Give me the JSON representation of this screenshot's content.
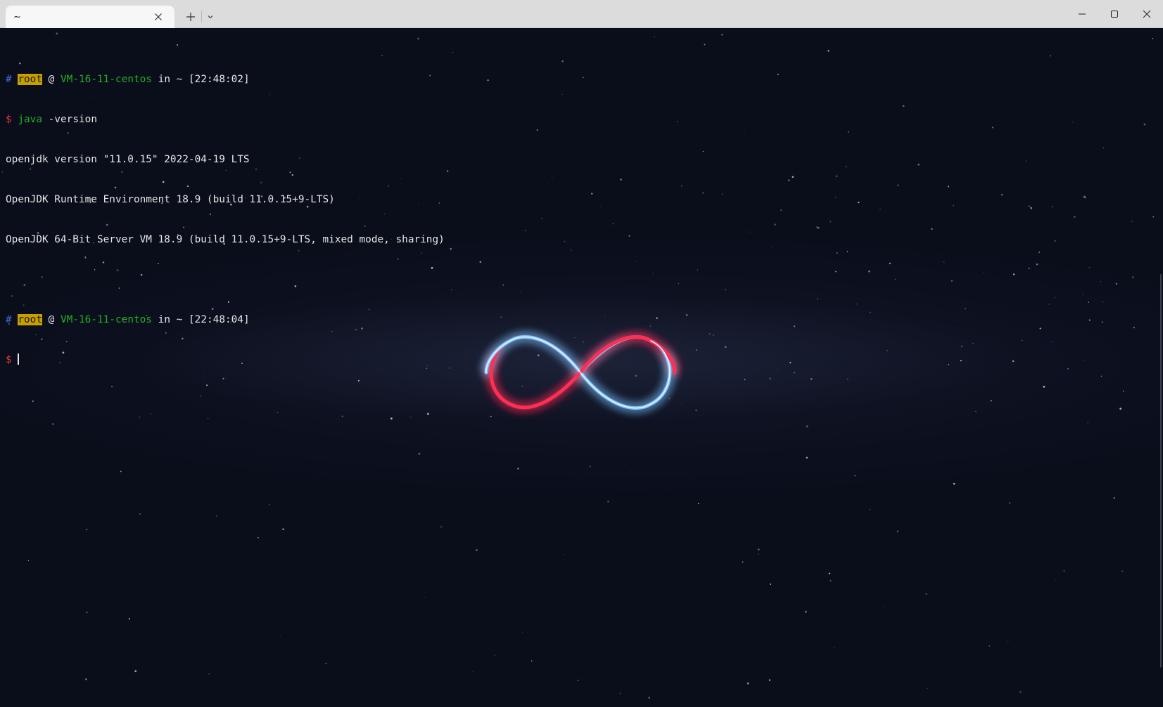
{
  "window": {
    "tab_title": "~",
    "new_tab_symbol": "+",
    "icons": {
      "tab_close": "close-icon",
      "new_tab": "plus-icon",
      "dropdown": "chevron-down-icon",
      "minimize": "minimize-icon",
      "maximize": "maximize-icon",
      "close": "close-icon"
    }
  },
  "terminal": {
    "prompt1": {
      "hash": "#",
      "user": "root",
      "at": "@",
      "host": "VM-16-11-centos",
      "in": "in",
      "dir": "~",
      "time": "[22:48:02]"
    },
    "command1": {
      "dollar": "$",
      "cmd": "java",
      "args": "-version"
    },
    "output": [
      "openjdk version \"11.0.15\" 2022-04-19 LTS",
      "OpenJDK Runtime Environment 18.9 (build 11.0.15+9-LTS)",
      "OpenJDK 64-Bit Server VM 18.9 (build 11.0.15+9-LTS, mixed mode, sharing)"
    ],
    "prompt2": {
      "hash": "#",
      "user": "root",
      "at": "@",
      "host": "VM-16-11-centos",
      "in": "in",
      "dir": "~",
      "time": "[22:48:04]"
    },
    "command2": {
      "dollar": "$"
    }
  },
  "colors": {
    "background": "#0a0d1a",
    "prompt_hash": "#3c6fe0",
    "prompt_dollar": "#e23a3a",
    "user_highlight": "#c7a000",
    "host_green": "#23b023",
    "text": "#e6e6e6",
    "infinity_blue": "#6fb8ff",
    "infinity_red": "#ff2d55"
  },
  "wallpaper": {
    "motif": "infinity-icon"
  }
}
